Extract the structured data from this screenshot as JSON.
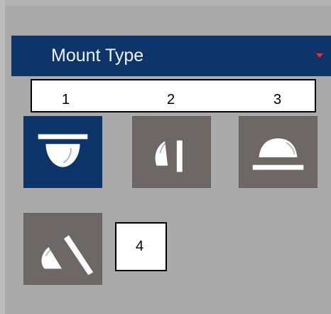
{
  "panel": {
    "title": "Mount Type",
    "labels": [
      "1",
      "2",
      "3",
      "4"
    ],
    "options": [
      {
        "name": "ceiling-mount",
        "icon": "ceiling-mount-icon",
        "selected": true
      },
      {
        "name": "wall-mount",
        "icon": "wall-mount-icon",
        "selected": false
      },
      {
        "name": "ground-mount",
        "icon": "ground-mount-icon",
        "selected": false
      },
      {
        "name": "angle-mount",
        "icon": "angle-mount-icon",
        "selected": false
      }
    ]
  },
  "colors": {
    "panel_bg": "#aaaaaa",
    "header_bg": "#0d356a",
    "selected_bg": "#0d356a",
    "tile_bg": "#6d6866",
    "accent_red": "#ff2a2a"
  }
}
